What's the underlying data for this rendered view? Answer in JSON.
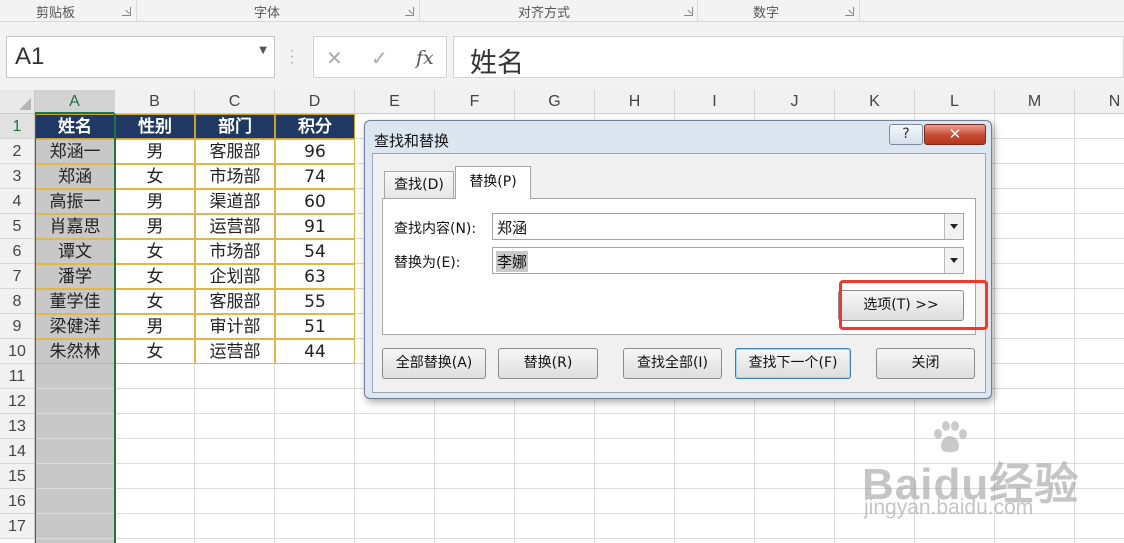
{
  "ribbon": {
    "groups": [
      "剪贴板",
      "字体",
      "对齐方式",
      "数字"
    ]
  },
  "formula_bar": {
    "name_box": "A1",
    "cancel_icon": "✕",
    "enter_icon": "✓",
    "fx_label": "fx",
    "formula": "姓名"
  },
  "sheet": {
    "columns": [
      "A",
      "B",
      "C",
      "D",
      "E",
      "F",
      "G",
      "H",
      "I",
      "J",
      "K",
      "L",
      "M",
      "N"
    ],
    "rows": [
      "1",
      "2",
      "3",
      "4",
      "5",
      "6",
      "7",
      "8",
      "9",
      "10",
      "11",
      "12",
      "13",
      "14",
      "15",
      "16",
      "17"
    ],
    "selected_cell": "A1",
    "header": [
      "姓名",
      "性别",
      "部门",
      "积分"
    ],
    "data": [
      [
        "郑涵一",
        "男",
        "客服部",
        "96"
      ],
      [
        "郑涵",
        "女",
        "市场部",
        "74"
      ],
      [
        "高振一",
        "男",
        "渠道部",
        "60"
      ],
      [
        "肖嘉思",
        "男",
        "运营部",
        "91"
      ],
      [
        "谭文",
        "女",
        "市场部",
        "54"
      ],
      [
        "潘学",
        "女",
        "企划部",
        "63"
      ],
      [
        "董学佳",
        "女",
        "客服部",
        "55"
      ],
      [
        "梁健洋",
        "男",
        "审计部",
        "51"
      ],
      [
        "朱然林",
        "女",
        "运营部",
        "44"
      ]
    ],
    "colors": {
      "header_fill": "#1f3864",
      "header_text": "#ffffff",
      "border": "#e0b84a",
      "selection": "#217346"
    }
  },
  "dialog": {
    "title": "查找和替换",
    "help": "?",
    "tabs": {
      "find": "查找(D)",
      "replace": "替换(P)"
    },
    "find_label": "查找内容(N):",
    "find_value": "郑涵",
    "replace_label": "替换为(E):",
    "replace_value": "李娜",
    "options_button": "选项(T) >>",
    "buttons": {
      "replace_all": "全部替换(A)",
      "replace": "替换(R)",
      "find_all": "查找全部(I)",
      "find_next": "查找下一个(F)",
      "close": "关闭"
    }
  },
  "watermark": {
    "logo": "Baidu经验",
    "url": "jingyan.baidu.com"
  }
}
